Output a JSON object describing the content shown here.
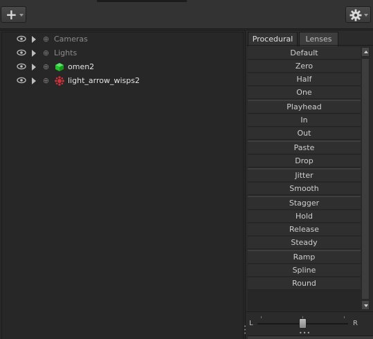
{
  "toolbar": {
    "add_icon": "plus-icon",
    "settings_icon": "gear-icon"
  },
  "tree": {
    "items": [
      {
        "label": "Cameras",
        "icon": null
      },
      {
        "label": "Lights",
        "icon": null
      },
      {
        "label": "omen2",
        "icon": "green-cube-icon"
      },
      {
        "label": "light_arrow_wisps2",
        "icon": "red-light-icon"
      }
    ]
  },
  "side": {
    "tabs": [
      "Procedural",
      "Lenses"
    ],
    "groups": [
      [
        "Default",
        "Zero",
        "Half",
        "One"
      ],
      [
        "Playhead",
        "In",
        "Out"
      ],
      [
        "Paste",
        "Drop"
      ],
      [
        "Jitter",
        "Smooth"
      ],
      [
        "Stagger",
        "Hold",
        "Release",
        "Steady"
      ],
      [
        "Ramp",
        "Spline",
        "Round"
      ]
    ],
    "slider": {
      "left_label": "L",
      "right_label": "R",
      "value": 0.5
    }
  },
  "colors": {
    "cube": "#22c22a",
    "light": "#d0303a"
  }
}
